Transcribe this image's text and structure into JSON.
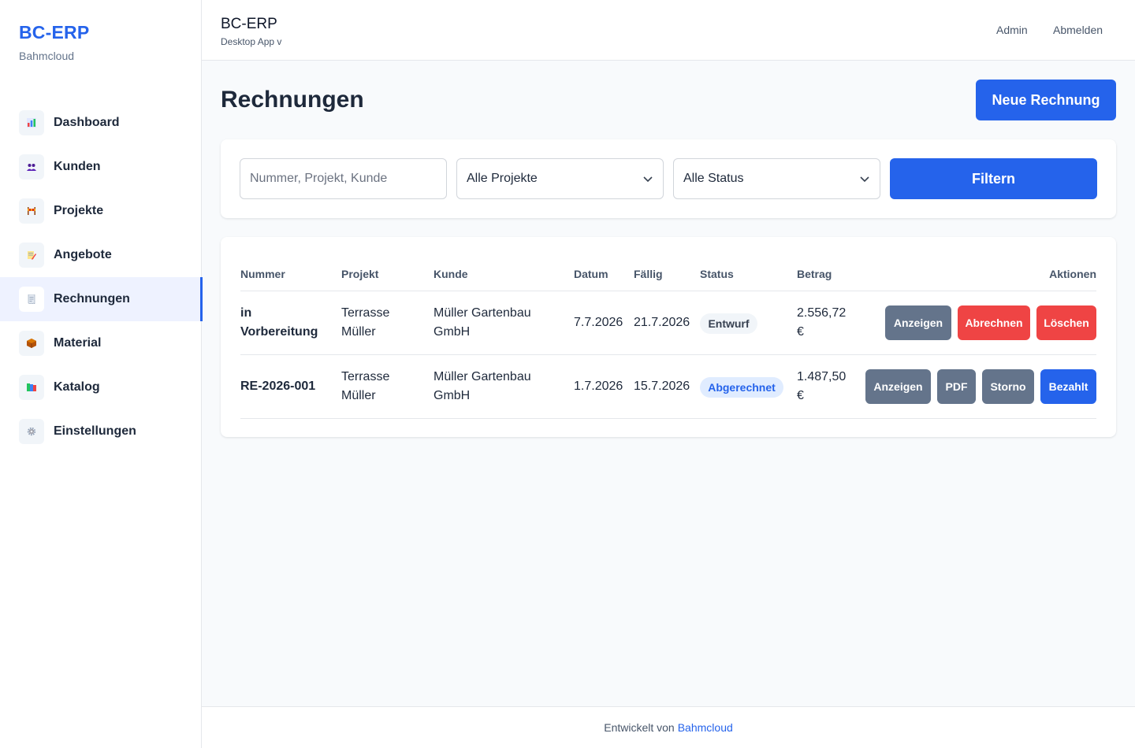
{
  "brand": {
    "title": "BC-ERP",
    "subtitle": "Bahmcloud"
  },
  "sidebar": {
    "items": [
      {
        "label": "Dashboard",
        "icon": "bar-chart-icon",
        "active": false
      },
      {
        "label": "Kunden",
        "icon": "users-icon",
        "active": false
      },
      {
        "label": "Projekte",
        "icon": "construction-icon",
        "active": false
      },
      {
        "label": "Angebote",
        "icon": "memo-icon",
        "active": false
      },
      {
        "label": "Rechnungen",
        "icon": "receipt-icon",
        "active": true
      },
      {
        "label": "Material",
        "icon": "package-icon",
        "active": false
      },
      {
        "label": "Katalog",
        "icon": "books-icon",
        "active": false
      },
      {
        "label": "Einstellungen",
        "icon": "gear-icon",
        "active": false
      }
    ]
  },
  "header": {
    "title": "BC-ERP",
    "subtitle": "Desktop App v",
    "admin_label": "Admin",
    "logout_label": "Abmelden"
  },
  "main": {
    "title": "Rechnungen",
    "new_button": "Neue Rechnung",
    "filters": {
      "search_placeholder": "Nummer, Projekt, Kunde",
      "project_select": "Alle Projekte",
      "status_select": "Alle Status",
      "filter_button": "Filtern"
    },
    "table": {
      "columns": [
        "Nummer",
        "Projekt",
        "Kunde",
        "Datum",
        "Fällig",
        "Status",
        "Betrag",
        "Aktionen"
      ],
      "rows": [
        {
          "nummer_line1": "in",
          "nummer_line2": "Vorbereitung",
          "projekt_line1": "Terrasse",
          "projekt_line2": "Müller",
          "kunde_line1": "Müller Gartenbau",
          "kunde_line2": "GmbH",
          "datum": "7.7.2026",
          "faellig": "21.7.2026",
          "status": "Entwurf",
          "betrag_line1": "2.556,72",
          "betrag_line2": "€",
          "actions": [
            "Anzeigen",
            "Abrechnen",
            "Löschen"
          ]
        },
        {
          "nummer": "RE-2026-001",
          "projekt_line1": "Terrasse",
          "projekt_line2": "Müller",
          "kunde_line1": "Müller Gartenbau",
          "kunde_line2": "GmbH",
          "datum": "1.7.2026",
          "faellig": "15.7.2026",
          "status": "Abgerechnet",
          "betrag_line1": "1.487,50",
          "betrag_line2": "€",
          "actions": [
            "Anzeigen",
            "PDF",
            "Storno",
            "Bezahlt"
          ]
        }
      ]
    }
  },
  "footer": {
    "text": "Entwickelt von",
    "link": "Bahmcloud"
  },
  "colors": {
    "primary": "#2563eb",
    "danger": "#ef4444",
    "secondary": "#64748b",
    "badge_draft_bg": "#f1f5f9",
    "badge_billed_bg": "#e0ecff"
  }
}
